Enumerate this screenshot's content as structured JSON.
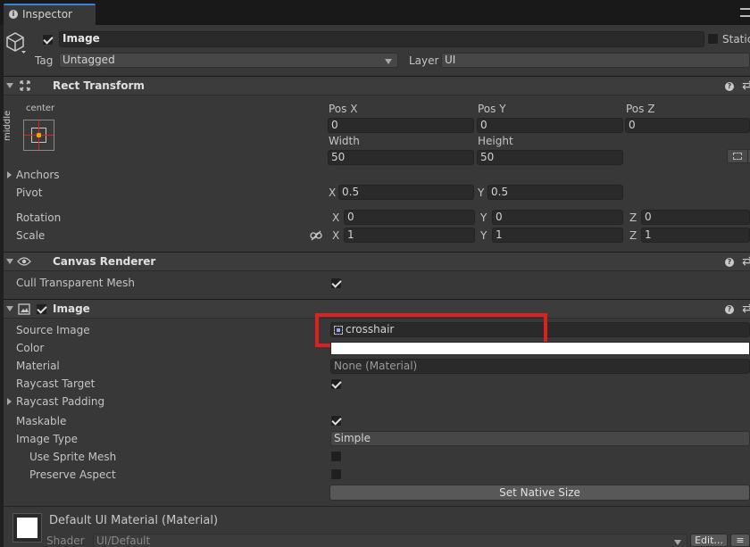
{
  "tab": {
    "title": "Inspector"
  },
  "object": {
    "name": "Image",
    "static_label": "Static",
    "tag_label": "Tag",
    "tag_value": "Untagged",
    "layer_label": "Layer",
    "layer_value": "UI"
  },
  "rect_transform": {
    "title": "Rect Transform",
    "anchor_h": "center",
    "anchor_v": "middle",
    "pos_x_label": "Pos X",
    "pos_x": "0",
    "pos_y_label": "Pos Y",
    "pos_y": "0",
    "pos_z_label": "Pos Z",
    "pos_z": "0",
    "width_label": "Width",
    "width": "50",
    "height_label": "Height",
    "height": "50",
    "anchors_label": "Anchors",
    "pivot_label": "Pivot",
    "pivot_x": "0.5",
    "pivot_y": "0.5",
    "rotation_label": "Rotation",
    "rot_x": "0",
    "rot_y": "0",
    "rot_z": "0",
    "scale_label": "Scale",
    "scale_x": "1",
    "scale_y": "1",
    "scale_z": "1",
    "axis_x": "X",
    "axis_y": "Y",
    "axis_z": "Z"
  },
  "canvas_renderer": {
    "title": "Canvas Renderer",
    "cull_label": "Cull Transparent Mesh",
    "cull_checked": true
  },
  "image": {
    "title": "Image",
    "source_image_label": "Source Image",
    "source_image_value": "crosshair",
    "color_label": "Color",
    "color_value": "#ffffff",
    "material_label": "Material",
    "material_value": "None (Material)",
    "raycast_target_label": "Raycast Target",
    "raycast_padding_label": "Raycast Padding",
    "maskable_label": "Maskable",
    "image_type_label": "Image Type",
    "image_type_value": "Simple",
    "use_sprite_mesh_label": "Use Sprite Mesh",
    "preserve_aspect_label": "Preserve Aspect",
    "set_native_size_label": "Set Native Size"
  },
  "material": {
    "title": "Default UI Material (Material)",
    "shader_label": "Shader",
    "shader_value": "UI/Default",
    "edit_label": "Edit..."
  },
  "colors": {
    "highlight": "#e0201f",
    "panel": "#383838",
    "header": "#3c3c3c"
  }
}
